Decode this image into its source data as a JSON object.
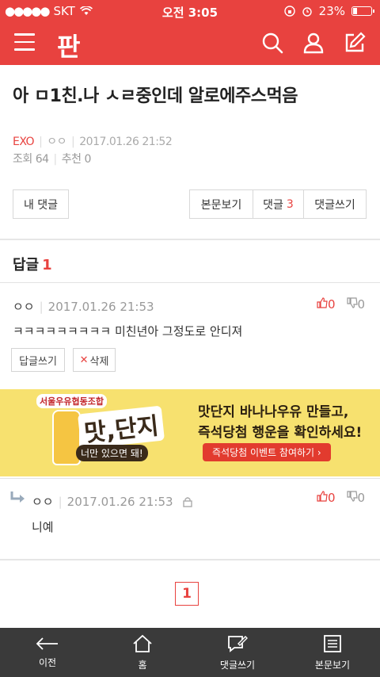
{
  "status_bar": {
    "carrier": "SKT",
    "time": "오전 3:05",
    "battery": "23%",
    "battery_level": 0.23
  },
  "nav": {
    "logo": "판",
    "icons": [
      "menu-icon",
      "search-icon",
      "user-icon",
      "edit-icon"
    ]
  },
  "post": {
    "title": "아 ㅁ1친.나 ㅅㄹ중인데 알로에주스먹음",
    "channel": "EXO",
    "author": "ㅇㅇ",
    "date": "2017.01.26 21:52",
    "views_label": "조회 64",
    "recommend_label": "추천 0"
  },
  "buttons": {
    "my_comments": "내 댓글",
    "view_post": "본문보기",
    "comments": "댓글",
    "comments_count": "3",
    "write_comment": "댓글쓰기"
  },
  "replies_section": {
    "label": "답글",
    "count": "1"
  },
  "comment1": {
    "author": "ㅇㅇ",
    "date": "2017.01.26 21:53",
    "up": "0",
    "down": "0",
    "text": "ㅋㅋㅋㅋㅋㅋㅋㅋㅋ 미친년아 그정도로 안디져",
    "reply_btn": "답글쓰기",
    "delete_btn": "삭제"
  },
  "ad": {
    "brand": "서울우유협동조합",
    "headline": "맛,단지",
    "tag": "너만 있으면 돼!",
    "line1": "맛단지 바나나우유 만들고,",
    "line2": "즉석당첨 행운을 확인하세요!",
    "cta": "즉석당첨 이벤트 참여하기 ›"
  },
  "comment2": {
    "author": "ㅇㅇ",
    "date": "2017.01.26 21:53",
    "up": "0",
    "down": "0",
    "text": "니예"
  },
  "pagination": {
    "current": "1"
  },
  "bottom_bar": {
    "back": "이전",
    "home": "홈",
    "write": "댓글쓰기",
    "view": "본문보기"
  },
  "colors": {
    "accent": "#e8423f",
    "bottom_bar": "#3a3a3a",
    "ad_bg": "#f7e16f"
  }
}
